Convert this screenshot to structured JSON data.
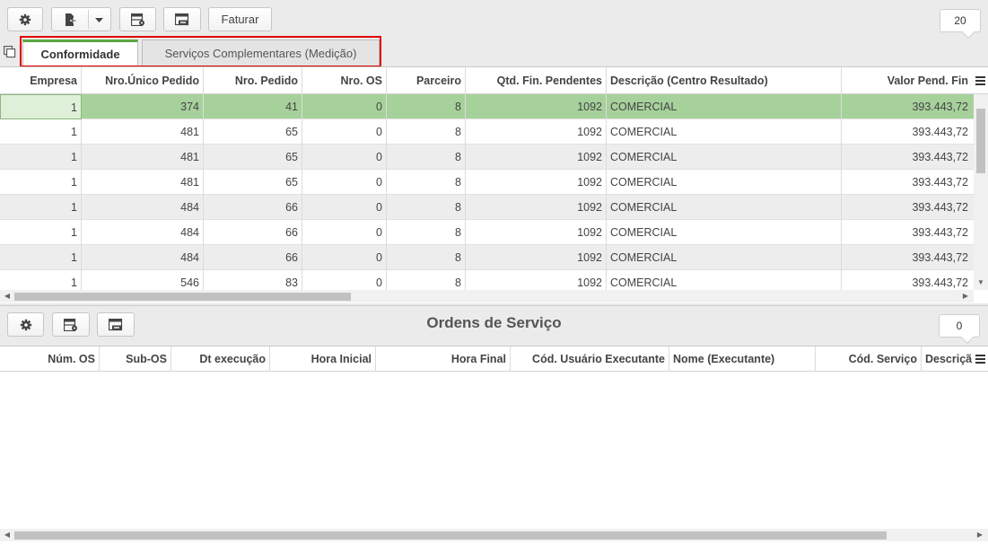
{
  "top_toolbar": {
    "faturar_label": "Faturar",
    "record_count": "20"
  },
  "tabs": [
    {
      "label": "Conformidade",
      "active": true
    },
    {
      "label": "Serviços Complementares (Medição)",
      "active": false
    }
  ],
  "main_grid": {
    "columns": [
      "Empresa",
      "Nro.Único Pedido",
      "Nro. Pedido",
      "Nro. OS",
      "Parceiro",
      "Qtd. Fin. Pendentes",
      "Descrição (Centro Resultado)",
      "Valor Pend. Fin"
    ],
    "rows": [
      [
        "1",
        "374",
        "41",
        "0",
        "8",
        "1092",
        "COMERCIAL",
        "393.443,72"
      ],
      [
        "1",
        "481",
        "65",
        "0",
        "8",
        "1092",
        "COMERCIAL",
        "393.443,72"
      ],
      [
        "1",
        "481",
        "65",
        "0",
        "8",
        "1092",
        "COMERCIAL",
        "393.443,72"
      ],
      [
        "1",
        "481",
        "65",
        "0",
        "8",
        "1092",
        "COMERCIAL",
        "393.443,72"
      ],
      [
        "1",
        "484",
        "66",
        "0",
        "8",
        "1092",
        "COMERCIAL",
        "393.443,72"
      ],
      [
        "1",
        "484",
        "66",
        "0",
        "8",
        "1092",
        "COMERCIAL",
        "393.443,72"
      ],
      [
        "1",
        "484",
        "66",
        "0",
        "8",
        "1092",
        "COMERCIAL",
        "393.443,72"
      ],
      [
        "1",
        "546",
        "83",
        "0",
        "8",
        "1092",
        "COMERCIAL",
        "393.443,72"
      ]
    ]
  },
  "bottom_section": {
    "title": "Ordens de Serviço",
    "record_count": "0",
    "columns": [
      "Núm. OS",
      "Sub-OS",
      "Dt execução",
      "Hora Inicial",
      "Hora Final",
      "Cód. Usuário Executante",
      "Nome (Executante)",
      "Cód. Serviço",
      "Descriçã"
    ]
  },
  "colors": {
    "selected_row": "#a7d19b",
    "active_tab_accent": "#5ba544",
    "highlight_box": "#e00000"
  }
}
